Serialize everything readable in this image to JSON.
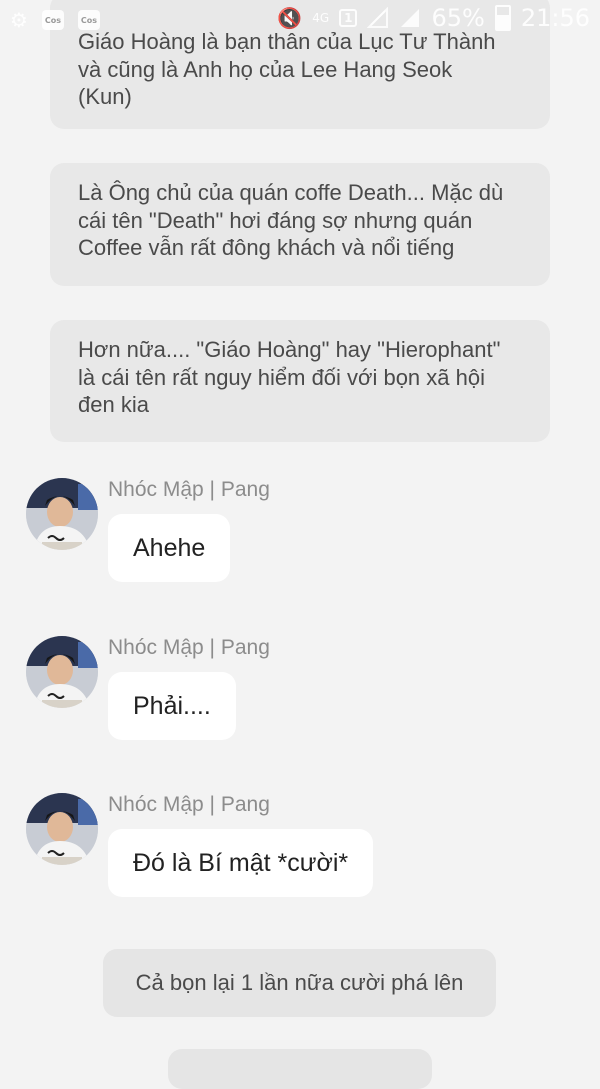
{
  "status_bar": {
    "icons": [
      "settings-gear-icon",
      "app-notification-icon",
      "app-notification-icon",
      "mute-icon",
      "4g-network-icon",
      "sim-1-icon",
      "no-signal-icon",
      "signal-icon",
      "battery-icon"
    ],
    "notif_label_1": "Cos",
    "notif_label_2": "Cos",
    "network_type": "4G",
    "sim_slot": "1",
    "battery_percent": "65%",
    "time": "21:56"
  },
  "narrations": [
    {
      "text": "Giáo Hoàng là bạn thân của Lục Tư Thành\nvà cũng là Anh họ của Lee Hang Seok\n(Kun)"
    },
    {
      "text": "Là Ông chủ của quán coffe Death... Mặc dù\ncái tên \"Death\" hơi đáng sợ nhưng quán\nCoffee vẫn rất đông khách và nổi tiếng"
    },
    {
      "text": "Hơn nữa.... \"Giáo Hoàng\" hay \"Hierophant\"\nlà cái tên rất nguy hiểm đối với bọn xã hội\nđen kia"
    }
  ],
  "messages": [
    {
      "sender": "Nhóc Mập | Pang",
      "text": "Ahehe"
    },
    {
      "sender": "Nhóc Mập | Pang",
      "text": "Phải...."
    },
    {
      "sender": "Nhóc Mập | Pang",
      "text": "Đó là Bí mật *cười*"
    }
  ],
  "final_narration": {
    "text": "Cả bọn lại 1 lần nữa cười phá lên"
  },
  "colors": {
    "background": "#f3f3f3",
    "narration_bg": "#e8e8e8",
    "message_bubble_bg": "#ffffff",
    "sender_name": "#8c8c8c",
    "text": "#222222"
  }
}
